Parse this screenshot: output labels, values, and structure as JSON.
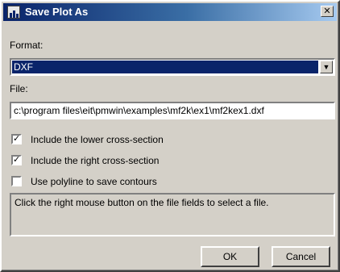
{
  "window": {
    "title": "Save Plot As",
    "close_glyph": "✕"
  },
  "format": {
    "label": "Format:",
    "selected": "DXF",
    "arrow_glyph": "▼"
  },
  "file": {
    "label": "File:",
    "value": "c:\\program files\\eit\\pmwin\\examples\\mf2k\\ex1\\mf2kex1.dxf"
  },
  "options": [
    {
      "label": "Include the lower cross-section",
      "checked": true
    },
    {
      "label": "Include the right cross-section",
      "checked": true
    },
    {
      "label": "Use polyline to save contours",
      "checked": false
    }
  ],
  "check_glyph": "✓",
  "info": {
    "text": "Click the right mouse button on the file fields to select a file."
  },
  "buttons": {
    "ok": "OK",
    "cancel": "Cancel"
  }
}
